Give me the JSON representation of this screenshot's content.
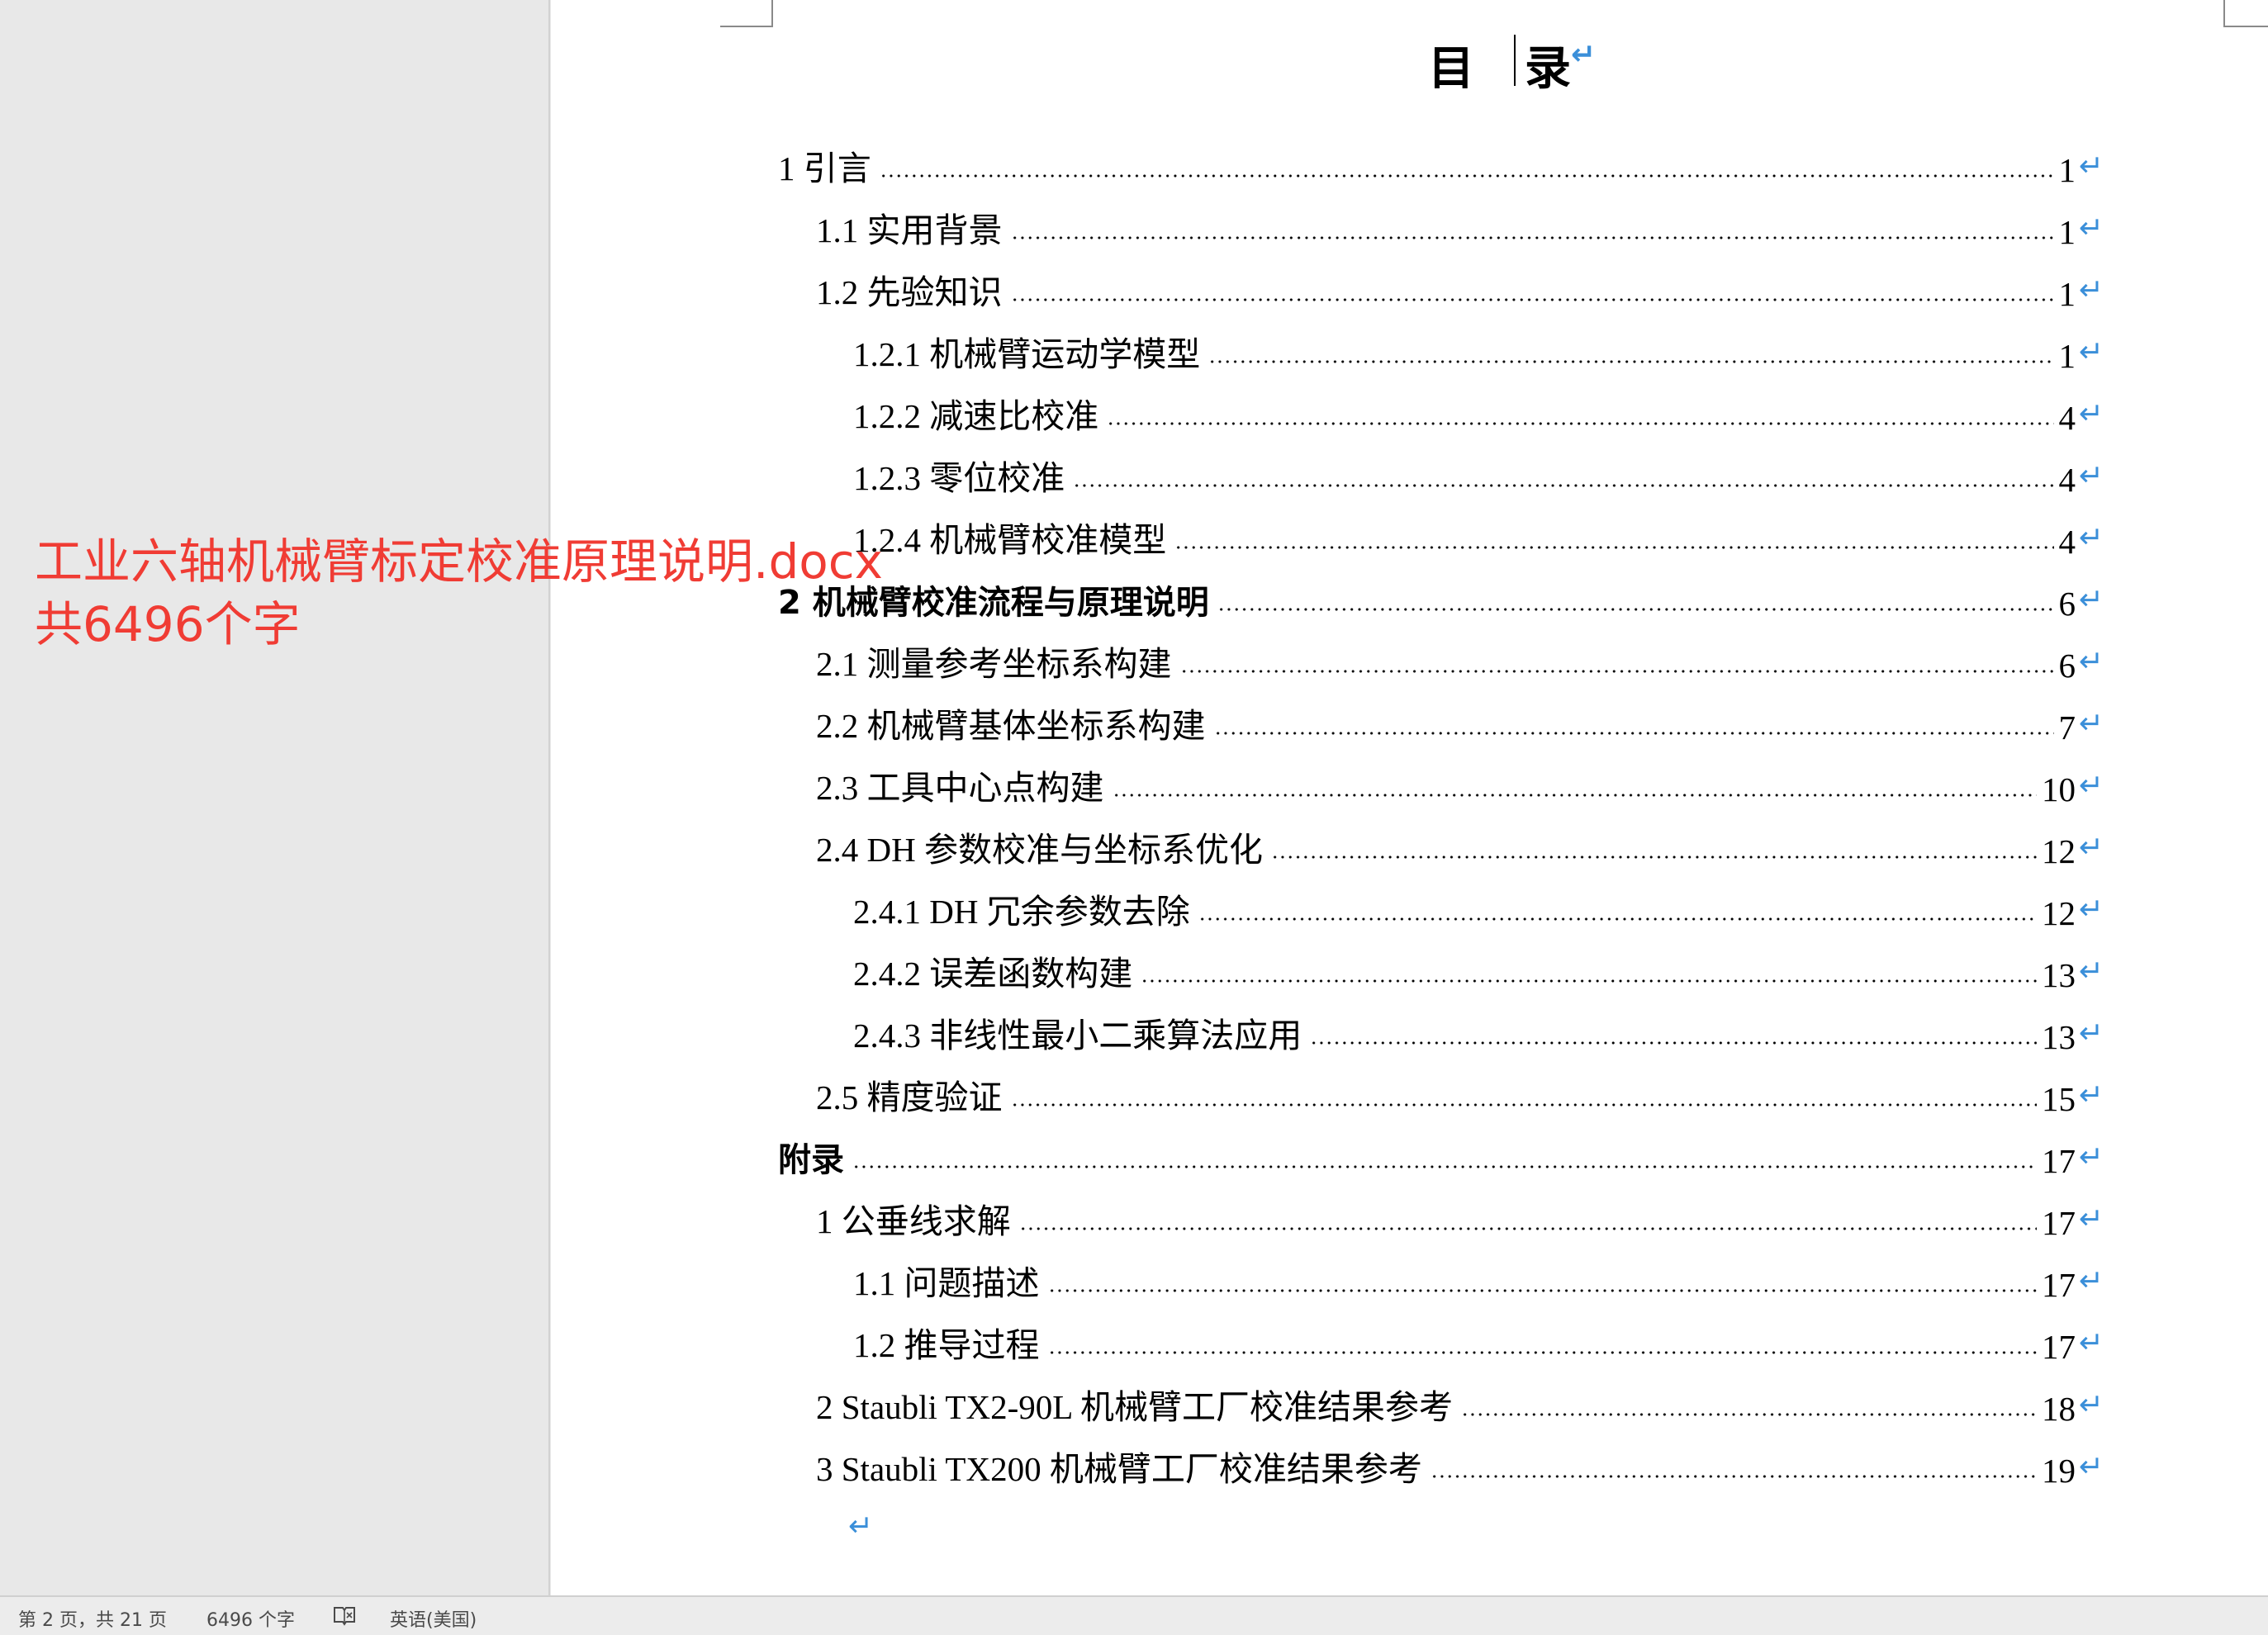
{
  "document": {
    "toc_title_char1": "目",
    "toc_title_char2": "录",
    "paragraph_mark": "↵",
    "entries": [
      {
        "label": "1  引言",
        "page": "1"
      },
      {
        "label": "1.1  实用背景",
        "page": "1"
      },
      {
        "label": "1.2  先验知识",
        "page": "1"
      },
      {
        "label": "1.2.1  机械臂运动学模型",
        "page": "1"
      },
      {
        "label": "1.2.2  减速比校准",
        "page": "4"
      },
      {
        "label": "1.2.3  零位校准",
        "page": "4"
      },
      {
        "label": "1.2.4  机械臂校准模型",
        "page": "4"
      },
      {
        "label": "2  机械臂校准流程与原理说明",
        "page": "6"
      },
      {
        "label": "2.1  测量参考坐标系构建",
        "page": "6"
      },
      {
        "label": "2.2  机械臂基体坐标系构建",
        "page": "7"
      },
      {
        "label": "2.3  工具中心点构建",
        "page": "10"
      },
      {
        "label": "2.4 DH 参数校准与坐标系优化",
        "page": "12"
      },
      {
        "label": "2.4.1 DH 冗余参数去除",
        "page": "12"
      },
      {
        "label": "2.4.2  误差函数构建",
        "page": "13"
      },
      {
        "label": "2.4.3  非线性最小二乘算法应用",
        "page": "13"
      },
      {
        "label": "2.5  精度验证",
        "page": "15"
      },
      {
        "label": "附录",
        "page": "17"
      },
      {
        "label": "1 公垂线求解",
        "page": "17"
      },
      {
        "label": "1.1 问题描述",
        "page": "17"
      },
      {
        "label": "1.2 推导过程",
        "page": "17"
      },
      {
        "label": "2 Staubli TX2-90L 机械臂工厂校准结果参考",
        "page": "18"
      },
      {
        "label": "3 Staubli TX200 机械臂工厂校准结果参考",
        "page": "19"
      }
    ]
  },
  "overlay": {
    "line1": "工业六轴机械臂标定校准原理说明.docx",
    "line2": "共6496个字"
  },
  "status_bar": {
    "page_info": "第 2 页，共 21 页",
    "word_count": "6496 个字",
    "language": "英语(美国)"
  },
  "colors": {
    "overlay_text": "#f03c34",
    "paragraph_mark": "#3b8fd9",
    "page_bg": "#ffffff",
    "workspace_bg": "#e8e8e8"
  },
  "icons": {
    "status_proofing": "book-check-icon"
  }
}
